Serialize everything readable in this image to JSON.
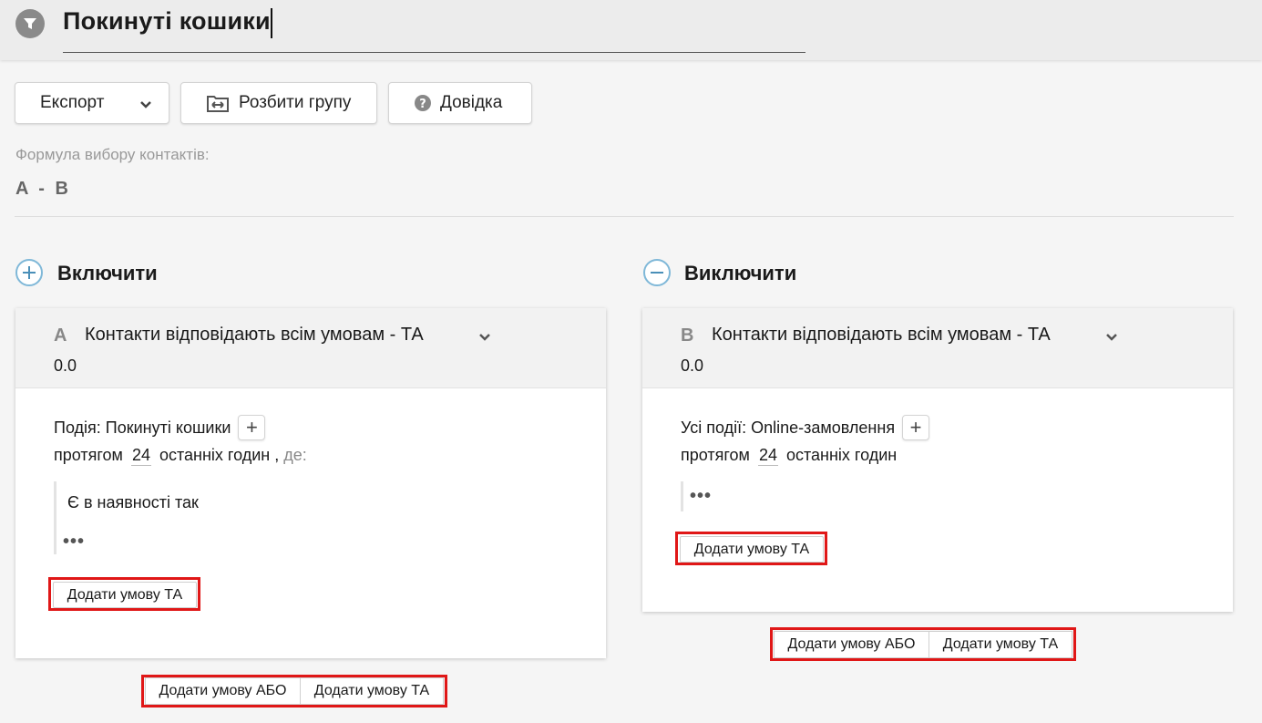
{
  "header": {
    "title": "Покинуті кошики",
    "icon": "filter-icon"
  },
  "toolbar": {
    "export_label": "Експорт",
    "split_label": "Розбити групу",
    "help_label": "Довідка"
  },
  "formula": {
    "label": "Формула вибору контактів:",
    "value": "A - B"
  },
  "include": {
    "title": "Включити",
    "card": {
      "letter": "A",
      "mode": "Контакти відповідають всім умовам - ТА",
      "score": "0.0",
      "event_text": "Подія: Покинуті кошики",
      "period_prefix": "протягом",
      "hours": "24",
      "period_suffix": "останніх годин",
      "comma": ",",
      "where": "де:",
      "condition": "Є в наявності  так",
      "more": "•••",
      "add_and": "Додати умову ТА"
    },
    "add_or": "Додати умову АБО",
    "add_and": "Додати умову ТА"
  },
  "exclude": {
    "title": "Виключити",
    "card": {
      "letter": "B",
      "mode": "Контакти відповідають всім умовам - ТА",
      "score": "0.0",
      "event_text": "Усі події: Online-замовлення",
      "period_prefix": "протягом",
      "hours": "24",
      "period_suffix": "останніх годин",
      "more": "•••",
      "add_and": "Додати умову ТА"
    },
    "add_or": "Додати умову АБО",
    "add_and": "Додати умову ТА"
  },
  "colors": {
    "highlight": "#e01717",
    "section_icon": "#7fb8d8"
  }
}
